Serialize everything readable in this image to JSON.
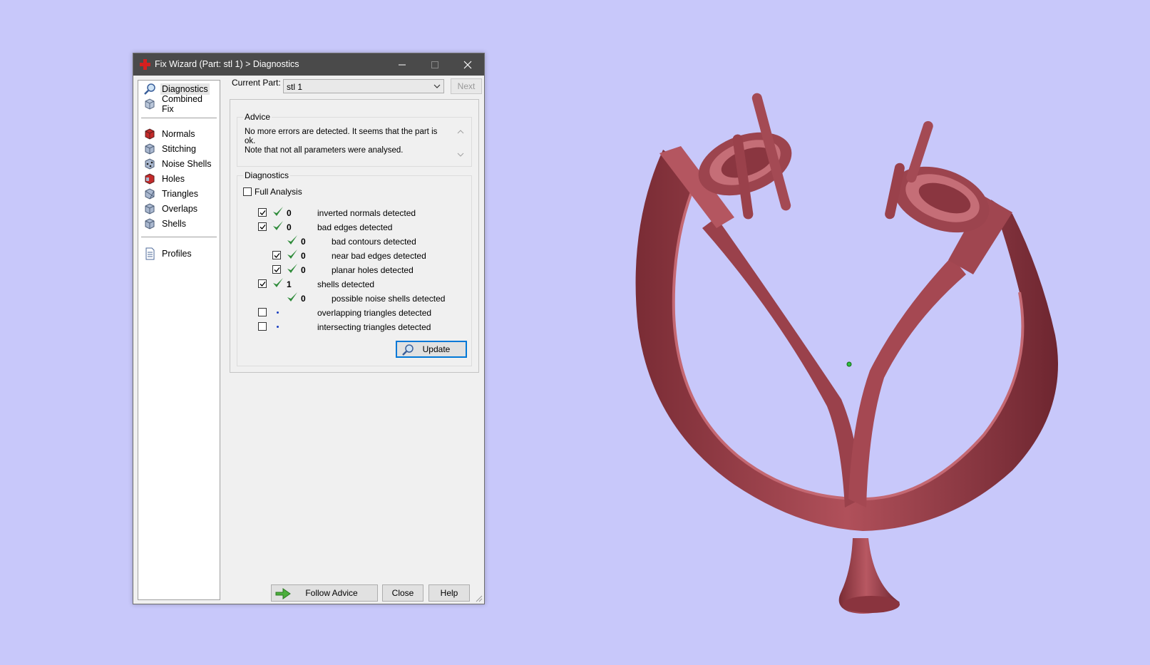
{
  "window": {
    "title": "Fix Wizard (Part: stl 1) > Diagnostics",
    "controls": [
      "minimize",
      "maximize",
      "close"
    ]
  },
  "nav": {
    "items": [
      {
        "label": "Diagnostics",
        "icon": "magnifier-icon",
        "selected": true
      },
      {
        "label": "Combined Fix",
        "icon": "combined-fix-icon"
      },
      {
        "label": "Normals",
        "icon": "normals-cube-icon"
      },
      {
        "label": "Stitching",
        "icon": "stitching-cube-icon"
      },
      {
        "label": "Noise Shells",
        "icon": "noise-shells-cube-icon"
      },
      {
        "label": "Holes",
        "icon": "holes-cube-icon"
      },
      {
        "label": "Triangles",
        "icon": "triangles-cube-icon"
      },
      {
        "label": "Overlaps",
        "icon": "overlaps-cube-icon"
      },
      {
        "label": "Shells",
        "icon": "shells-cube-icon"
      },
      {
        "label": "Profiles",
        "icon": "profiles-document-icon"
      }
    ]
  },
  "current_part": {
    "label": "Current Part:",
    "value": "stl 1",
    "next_label": "Next"
  },
  "advice": {
    "title": "Advice",
    "text": "No more errors are detected. It seems that the part is ok.\nNote that not all parameters were analysed."
  },
  "diagnostics": {
    "title": "Diagnostics",
    "full_analysis_label": "Full Analysis",
    "full_analysis_checked": false,
    "rows": [
      {
        "checkbox": true,
        "checked": true,
        "status": "ok",
        "count": "0",
        "label": "inverted normals detected",
        "indent": 0
      },
      {
        "checkbox": true,
        "checked": true,
        "status": "ok",
        "count": "0",
        "label": "bad edges detected",
        "indent": 0
      },
      {
        "checkbox": false,
        "checked": false,
        "status": "ok",
        "count": "0",
        "label": "bad contours detected",
        "indent": 1
      },
      {
        "checkbox": true,
        "checked": true,
        "status": "ok",
        "count": "0",
        "label": "near bad edges detected",
        "indent": 1
      },
      {
        "checkbox": true,
        "checked": true,
        "status": "ok",
        "count": "0",
        "label": "planar holes detected",
        "indent": 1
      },
      {
        "checkbox": true,
        "checked": true,
        "status": "ok",
        "count": "1",
        "label": "shells detected",
        "indent": 0
      },
      {
        "checkbox": false,
        "checked": false,
        "status": "ok",
        "count": "0",
        "label": "possible noise shells detected",
        "indent": 1
      },
      {
        "checkbox": true,
        "checked": false,
        "status": "pending",
        "count": "",
        "label": "overlapping triangles detected",
        "indent": 0
      },
      {
        "checkbox": true,
        "checked": false,
        "status": "pending",
        "count": "",
        "label": "intersecting triangles detected",
        "indent": 0
      }
    ],
    "update_label": "Update"
  },
  "footer": {
    "follow_advice_label": "Follow Advice",
    "close_label": "Close",
    "help_label": "Help"
  },
  "colors": {
    "background": "#c8c8fa",
    "model": "#a84850",
    "titlebar": "#4a4a4a",
    "tick_green": "#2e8b3a",
    "accent": "#0078d7"
  }
}
